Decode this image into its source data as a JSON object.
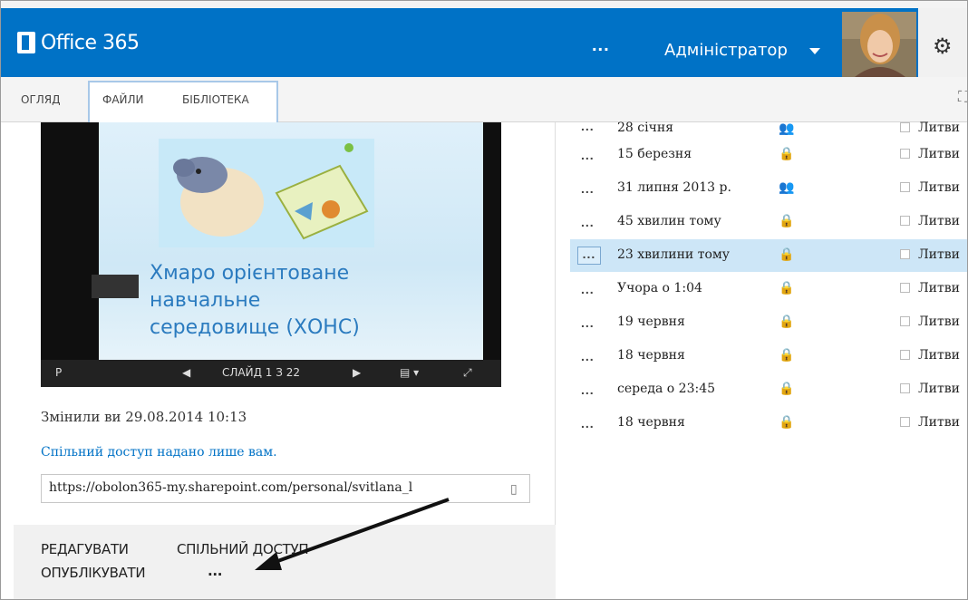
{
  "header": {
    "app_title": "Office 365",
    "more": "...",
    "user_name": "Адміністратор",
    "brand_color": "#0072c6"
  },
  "tabs": [
    {
      "label": "ОГЛЯД"
    },
    {
      "label": "ФАЙЛИ"
    },
    {
      "label": "БІБЛІОТЕКА"
    }
  ],
  "preview": {
    "slide_title_lines": [
      "Хмаро орієнтоване",
      "навчальне",
      "середовище (ХОНС)"
    ],
    "slide_counter": "СЛАЙД 1 З 22"
  },
  "details": {
    "modified": "Змінили ви 29.08.2014 10:13",
    "sharing": "Спільний доступ надано лише вам.",
    "url": "https://obolon365-my.sharepoint.com/personal/svitlana_l"
  },
  "actions": {
    "edit": "РЕДАГУВАТИ",
    "share": "СПІЛЬНИЙ ДОСТУП",
    "publish": "ОПУБЛІКУВАТИ",
    "more": "..."
  },
  "files": [
    {
      "date": "28 січня",
      "sharing": "shared-icon",
      "owner": "Литви"
    },
    {
      "date": "15 березня",
      "sharing": "lock-icon",
      "owner": "Литви"
    },
    {
      "date": "31 липня 2013 р.",
      "sharing": "shared-icon",
      "owner": "Литви"
    },
    {
      "date": "45 хвилин тому",
      "sharing": "lock-icon",
      "owner": "Литви"
    },
    {
      "date": "23 хвилини тому",
      "sharing": "lock-icon",
      "owner": "Литви"
    },
    {
      "date": "Учора о 1:04",
      "sharing": "lock-icon",
      "owner": "Литви"
    },
    {
      "date": "19 червня",
      "sharing": "lock-icon",
      "owner": "Литви"
    },
    {
      "date": "18 червня",
      "sharing": "lock-icon",
      "owner": "Литви"
    },
    {
      "date": "середа о 23:45",
      "sharing": "lock-icon",
      "owner": "Литви"
    },
    {
      "date": "18 червня",
      "sharing": "lock-icon",
      "owner": "Литви"
    }
  ],
  "row_dots": "..."
}
